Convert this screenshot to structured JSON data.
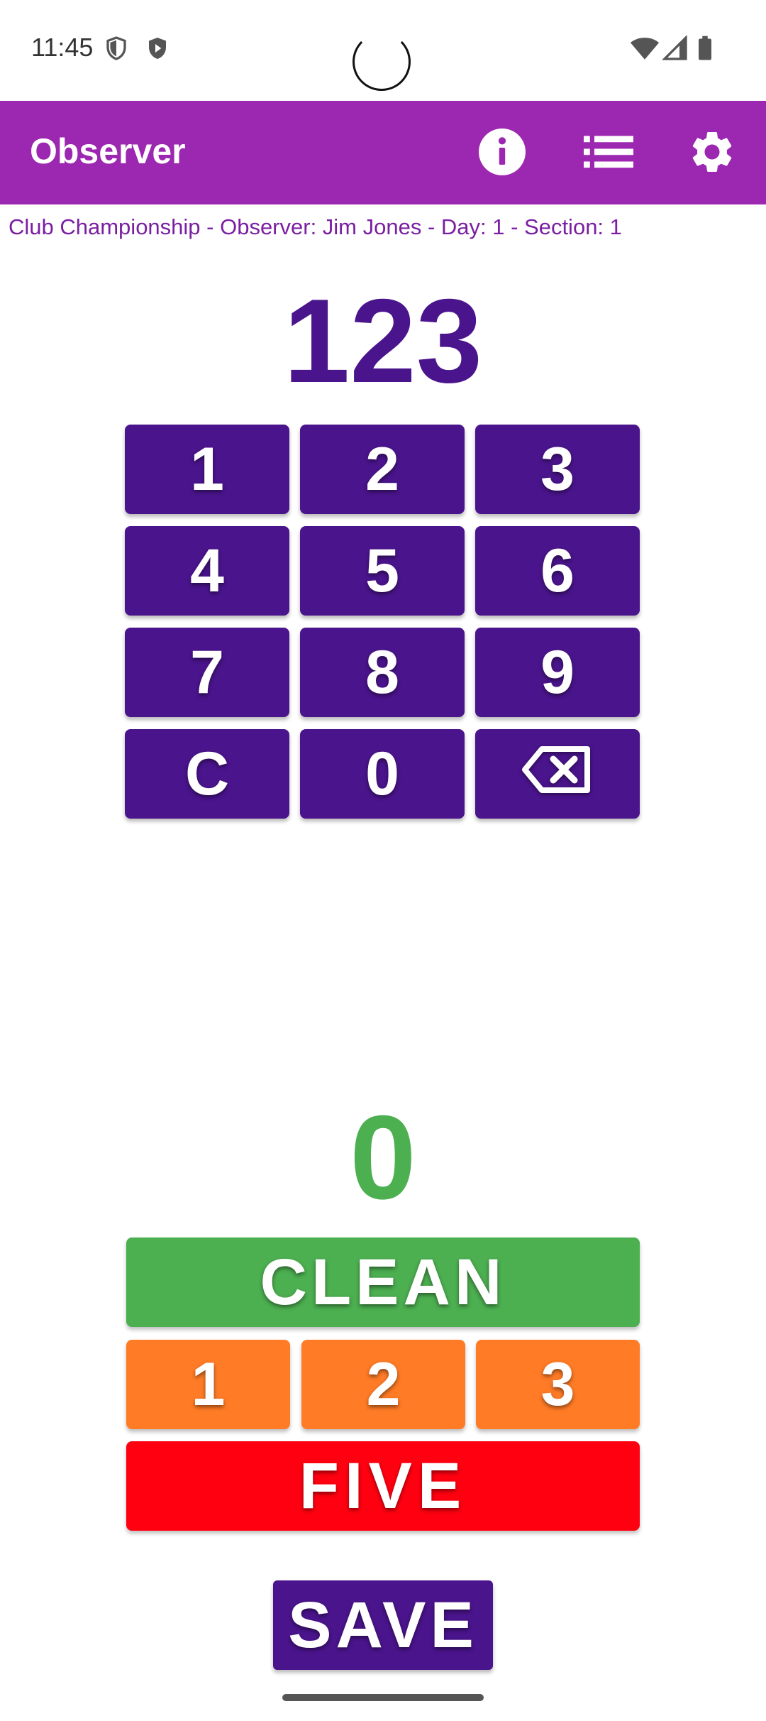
{
  "status_bar": {
    "time": "11:45",
    "icons_left": [
      "shield-icon",
      "play-shield-icon"
    ],
    "icons_right": [
      "wifi-icon",
      "signal-icon",
      "battery-icon"
    ]
  },
  "app_bar": {
    "title": "Observer",
    "background": "#9c27b0",
    "actions": [
      "info-icon",
      "list-icon",
      "settings-icon"
    ]
  },
  "context_line": "Club Championship - Observer: Jim Jones - Day: 1 - Section: 1",
  "entry": {
    "value": "123",
    "color": "#4a148c"
  },
  "keypad": {
    "color": "#4a148c",
    "keys": [
      "1",
      "2",
      "3",
      "4",
      "5",
      "6",
      "7",
      "8",
      "9",
      "C",
      "0"
    ],
    "backspace_icon": "backspace-icon"
  },
  "score": {
    "value": "0",
    "color": "#4caf50"
  },
  "score_buttons": {
    "clean": "CLEAN",
    "clean_color": "#4caf50",
    "dabs": [
      "1",
      "2",
      "3"
    ],
    "dab_color": "#ff7b26",
    "five": "FIVE",
    "five_color": "#ff0010"
  },
  "save_label": "SAVE"
}
